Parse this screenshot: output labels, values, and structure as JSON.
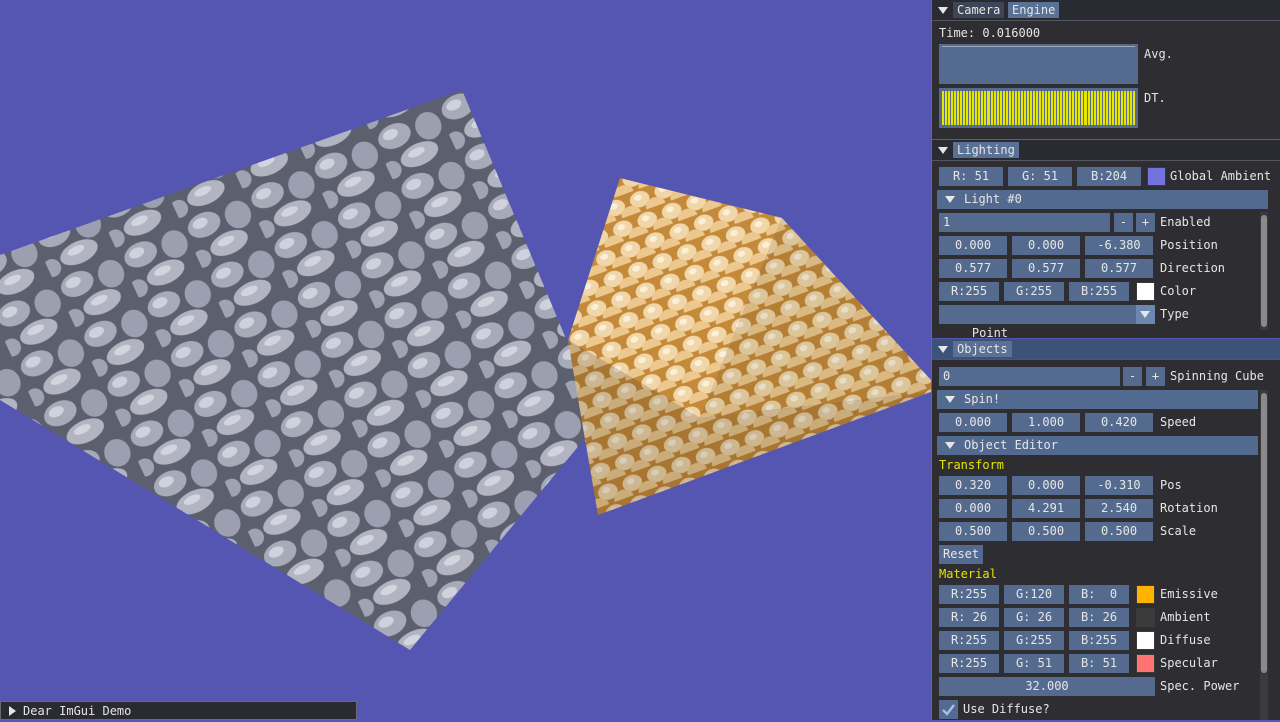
{
  "colors": {
    "viewport_bg": "#5555b2",
    "global_ambient": "#7373e0",
    "light_color": "#ffffff",
    "emissive": "#ffb300",
    "ambient": "#3b3b3b",
    "diffuse": "#ffffff",
    "specular": "#ff7373",
    "plot_bar": "#e6e600"
  },
  "engine": {
    "tabs": [
      "Camera",
      "Engine"
    ],
    "time": "Time: 0.016000",
    "avg_label": "Avg.",
    "dt_label": "DT.",
    "dt_bar_count": 64
  },
  "lighting": {
    "tab": "Lighting",
    "ambient_r": "R: 51",
    "ambient_g": "G: 51",
    "ambient_b": "B:204",
    "ambient_label": "Global Ambient",
    "light_header": "Light #0",
    "light_index": "1",
    "minus": "-",
    "plus": "+",
    "enabled_label": "Enabled",
    "pos": [
      "0.000",
      "0.000",
      "-6.380"
    ],
    "pos_label": "Position",
    "dir": [
      "0.577",
      "0.577",
      "0.577"
    ],
    "dir_label": "Direction",
    "color_r": "R:255",
    "color_g": "G:255",
    "color_b": "B:255",
    "color_label": "Color",
    "type_value": "Point",
    "type_label": "Type"
  },
  "objects": {
    "tab": "Objects",
    "index": "0",
    "minus": "-",
    "plus": "+",
    "object_name": "Spinning Cube",
    "spin_header": "Spin!",
    "speed": [
      "0.000",
      "1.000",
      "0.420"
    ],
    "speed_label": "Speed",
    "editor_header": "Object Editor",
    "transform_label": "Transform",
    "pos": [
      "0.320",
      "0.000",
      "-0.310"
    ],
    "pos_label": "Pos",
    "rotation": [
      "0.000",
      "4.291",
      "2.540"
    ],
    "rotation_label": "Rotation",
    "scale": [
      "0.500",
      "0.500",
      "0.500"
    ],
    "scale_label": "Scale",
    "reset": "Reset",
    "material_label": "Material",
    "emissive": [
      "R:255",
      "G:120",
      "B:  0"
    ],
    "emissive_label": "Emissive",
    "ambient": [
      "R: 26",
      "G: 26",
      "B: 26"
    ],
    "ambient_label": "Ambient",
    "diffuse": [
      "R:255",
      "G:255",
      "B:255"
    ],
    "diffuse_label": "Diffuse",
    "specular": [
      "R:255",
      "G: 51",
      "B: 51"
    ],
    "specular_label": "Specular",
    "spec_power": "32.000",
    "spec_power_label": "Spec. Power",
    "use_diffuse": "Use Diffuse?",
    "use_diffuse_checked": true
  },
  "demo_window": {
    "title": "Dear ImGui Demo"
  }
}
